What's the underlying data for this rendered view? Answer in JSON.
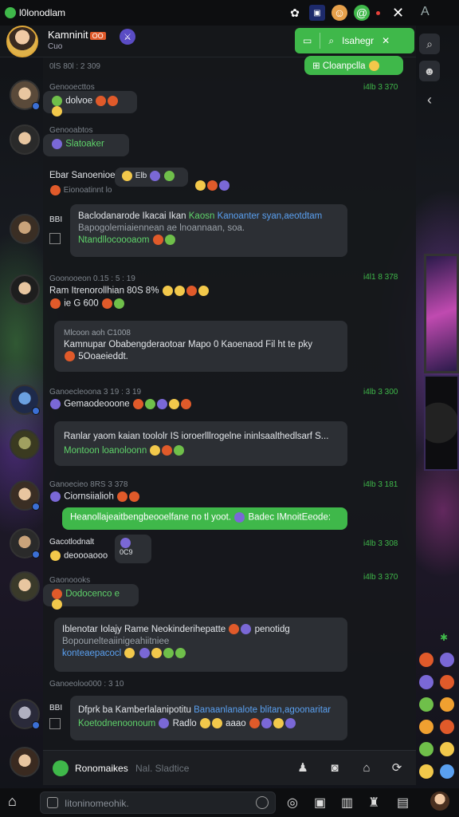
{
  "status_bar": {
    "app_name": "l0lonodlam",
    "icons": [
      "flower-icon",
      "image-icon",
      "face-icon",
      "at-icon"
    ]
  },
  "header": {
    "title": "Kamninit",
    "badge": "OO",
    "subtitle": "Cuo",
    "search_label": "Isahegr",
    "top_pill": "Cloanpclla"
  },
  "messages": [
    {
      "meta": "0lS 80l : 2 309",
      "text": "",
      "time": ""
    },
    {
      "meta": "Genooecttos",
      "text": "dolvoe",
      "time": "i4lb 3 370"
    },
    {
      "meta": "Genooabtos",
      "text": "Slatoaker",
      "time": ""
    },
    {
      "meta": "",
      "text": "Ebar Sanoenioe",
      "sub": "Eionoatinnt lo",
      "extra": "Elb",
      "time": ""
    },
    {
      "meta": "BBI",
      "text": "Baclodanarode Ikacai Ikan",
      "text_green": "Kaosn",
      "text_blue": "Kanoanter syan,aeotdtam",
      "sub": "Bapogolemiaiennean ae lnoannaan, soa.",
      "extra": "Ntandllocoooaom",
      "time": ""
    },
    {
      "meta": "Goonooeon 0.15 : 5 : 19",
      "text": "Ram Itrenorollhian 80S 8%",
      "sub": "ie G 600",
      "time": "i4l1 8 378"
    },
    {
      "meta": "Mlcoon aoh C1008",
      "text": "Kamnupar Obabengderaotoar Mapo 0 Kaoenaod Fil ht te pky",
      "sub": "5Ooaeieddt.",
      "time": ""
    },
    {
      "meta": "Ganoecleoona 3 19 : 3 19",
      "text": "Gemaodeooone",
      "time": "i4lb 3 300"
    },
    {
      "meta": "",
      "text": "Ranlar yaom kaian toololr IS ioroerlllrogelne ininlsaalthedlsarf S...",
      "extra": "Montoon loanoloonn",
      "time": ""
    },
    {
      "meta": "Ganoecieo 8RS 3 378",
      "text": "Ciornsiialioh",
      "time": "i4lb 3 181"
    },
    {
      "meta": "",
      "text": "Heanollajeaitbengbeooelfane no tl yoot.",
      "extra": "Badec IMnoitEeode:",
      "time": ""
    },
    {
      "meta": "Gacotlodnalt",
      "text": "deoooaooo",
      "extra": "0C9",
      "time": "i4lb 3 308"
    },
    {
      "meta": "Gaonoooks",
      "text": "Dodocenco e",
      "time": "i4lb 3 370"
    },
    {
      "meta": "",
      "text": "Iblenotar Iolajy Rame Neokinderihepatte",
      "extra2": "penotidg",
      "sub": "Bopounelteaiinigeahiitniee",
      "extra": "konteaepacocl",
      "time": ""
    },
    {
      "meta": "Ganoeoloo000 : 3 10",
      "text": "",
      "time": ""
    },
    {
      "meta": "BBI",
      "text": "Dfprk ba Kamberlalanipotitu",
      "text_blue": "Banaanlanalote blitan,agoonaritar",
      "extra": "Koetodnenoonoum",
      "extra2": "Radlo",
      "extra3": "aaao",
      "time": ""
    }
  ],
  "composer": {
    "name": "Ronomaikes",
    "hint": "Nal. Sladtice"
  },
  "bottom_bar": {
    "placeholder": "Iitoninomeohik."
  }
}
